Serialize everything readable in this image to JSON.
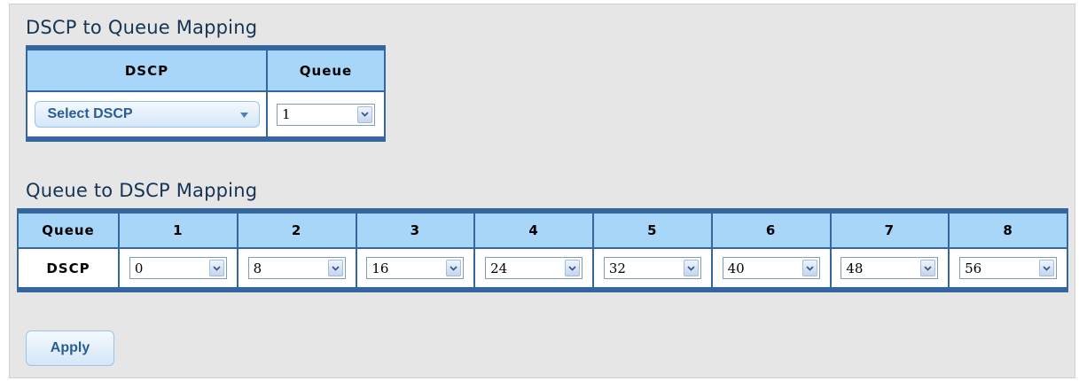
{
  "dscp_to_queue": {
    "title": "DSCP to Queue Mapping",
    "col_dscp": "DSCP",
    "col_queue": "Queue",
    "dscp_select_label": "Select DSCP",
    "queue_value": "1"
  },
  "queue_to_dscp": {
    "title": "Queue to DSCP Mapping",
    "row_queue_label": "Queue",
    "row_dscp_label": "DSCP",
    "queues": [
      "1",
      "2",
      "3",
      "4",
      "5",
      "6",
      "7",
      "8"
    ],
    "dscp_values": [
      "0",
      "8",
      "16",
      "24",
      "32",
      "40",
      "48",
      "56"
    ]
  },
  "apply_label": "Apply",
  "icons": {
    "select_arrow": "chevron-down-icon",
    "dropdown_caret": "caret-down-icon"
  },
  "colors": {
    "header_bg": "#a8d6f8",
    "table_border": "#3466a0",
    "title_text": "#163453",
    "button_text": "#2a5c93",
    "panel_bg": "#e6e6e6"
  }
}
